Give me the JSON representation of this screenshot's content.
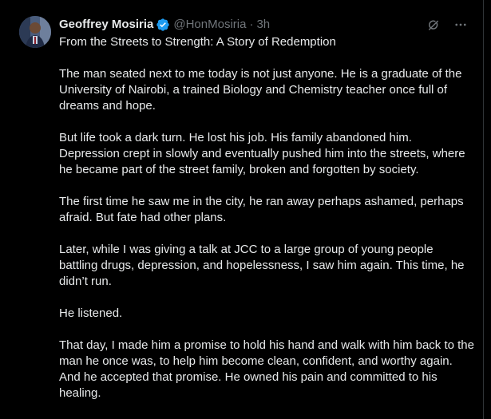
{
  "author": {
    "name": "Geoffrey Mosiria",
    "handle": "@HonMosiria",
    "separator": "·",
    "time": "3h",
    "verified_color": "#1d9bf0"
  },
  "icons": {
    "grok": "grok-icon",
    "more": "more-icon",
    "verified": "verified-badge-icon"
  },
  "post": {
    "title": "From the Streets to Strength: A Story of Redemption",
    "paragraphs": [
      "The man seated next to me today is not just anyone. He is a graduate of the University of Nairobi, a trained Biology and Chemistry teacher once full of dreams and hope.",
      "But life took a dark turn. He lost his job. His family abandoned him. Depression crept in slowly and eventually pushed him into the streets, where he became part of the street family, broken and forgotten by society.",
      "The first time he saw me in the city, he ran away perhaps ashamed, perhaps afraid. But fate had other plans.",
      "Later, while I was giving a talk at JCC to a large group of young people battling drugs, depression, and hopelessness, I saw him again. This time, he didn’t run.",
      "He listened.",
      "That day, I made him a promise to hold his hand and walk with him back to the man he once was, to help him become clean, confident, and worthy again. And he accepted that promise. He owned his pain and committed to his healing."
    ]
  },
  "colors": {
    "background": "#000000",
    "text": "#e7e9ea",
    "muted": "#71767b",
    "accent": "#1d9bf0"
  }
}
